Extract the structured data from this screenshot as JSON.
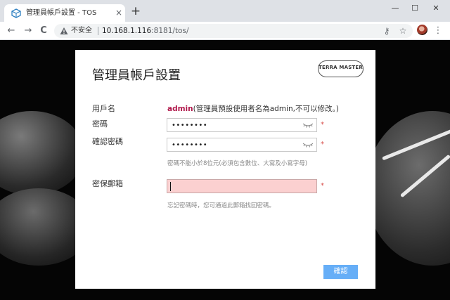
{
  "browser": {
    "tab_title": "管理員帳戶設置 - TOS",
    "tab_close": "×",
    "new_tab": "+",
    "window_controls": {
      "minimize": "—",
      "maximize": "☐",
      "close": "✕"
    },
    "nav": {
      "back": "←",
      "forward": "→",
      "reload": "C"
    },
    "security_label": "不安全",
    "url_host": "10.168.1.116",
    "url_rest": ":8181/tos/",
    "key_icon": "key-icon",
    "star_icon": "star-icon",
    "menu_icon": "⋮"
  },
  "dialog": {
    "title": "管理員帳戶設置",
    "logo_text": "TERRA MASTER",
    "username_label": "用戶名",
    "username_value": "admin",
    "username_note": "(管理員預設使用者名為admin,不可以修改。)",
    "password_label": "密碼",
    "password_value": "••••••••",
    "confirm_password_label": "確認密碼",
    "confirm_password_value": "••••••••",
    "required_mark": "*",
    "password_hint": "密碼不能小於8位元(必須包含數位、大寫及小寫字母)",
    "email_label": "密保郵箱",
    "email_value": "",
    "email_hint": "忘記密碼時，您可通過此郵箱找回密碼。",
    "confirm_button": "確認"
  },
  "colors": {
    "accent": "#66aef7",
    "admin_text": "#b0174a",
    "required": "#d9534f",
    "email_invalid_bg": "#fbd0d0"
  }
}
